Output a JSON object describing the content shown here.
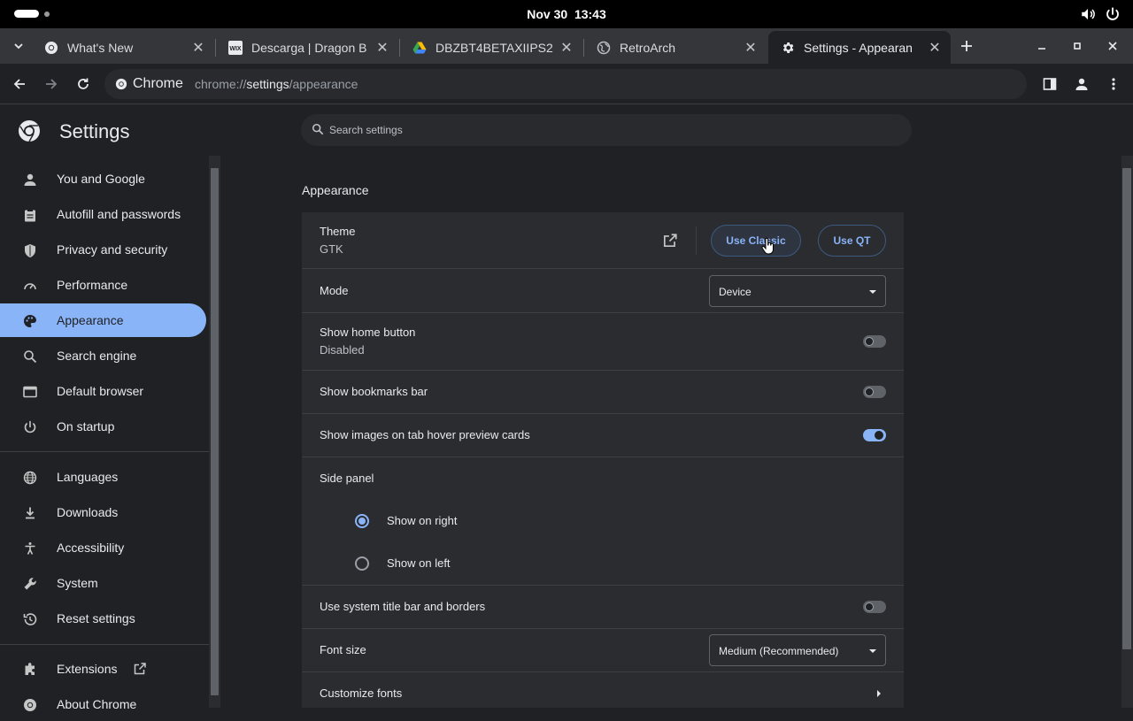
{
  "system": {
    "date": "Nov 30",
    "time": "13:43"
  },
  "tabs": [
    {
      "title": "What's New",
      "icon": "chrome-icon"
    },
    {
      "title": "Descarga | Dragon B",
      "icon": "wix-icon"
    },
    {
      "title": "DBZBT4BETAXIIPS2",
      "icon": "google-drive-icon"
    },
    {
      "title": "RetroArch",
      "icon": "globe-icon"
    },
    {
      "title": "Settings - Appearan",
      "icon": "gear-icon"
    }
  ],
  "toolbar": {
    "chip_label": "Chrome",
    "url_prefix": "chrome://",
    "url_path": "settings",
    "url_suffix": "/appearance"
  },
  "settings": {
    "title": "Settings",
    "search_placeholder": "Search settings"
  },
  "sidebar": {
    "items": [
      {
        "label": "You and Google",
        "icon": "person-icon"
      },
      {
        "label": "Autofill and passwords",
        "icon": "clipboard-icon"
      },
      {
        "label": "Privacy and security",
        "icon": "shield-icon"
      },
      {
        "label": "Performance",
        "icon": "speedometer-icon"
      },
      {
        "label": "Appearance",
        "icon": "palette-icon"
      },
      {
        "label": "Search engine",
        "icon": "search-icon"
      },
      {
        "label": "Default browser",
        "icon": "browser-icon"
      },
      {
        "label": "On startup",
        "icon": "power-icon"
      },
      {
        "label": "Languages",
        "icon": "globe-icon"
      },
      {
        "label": "Downloads",
        "icon": "download-icon"
      },
      {
        "label": "Accessibility",
        "icon": "accessibility-icon"
      },
      {
        "label": "System",
        "icon": "wrench-icon"
      },
      {
        "label": "Reset settings",
        "icon": "history-icon"
      },
      {
        "label": "Extensions",
        "icon": "puzzle-icon"
      },
      {
        "label": "About Chrome",
        "icon": "chrome-icon"
      }
    ],
    "selected": "Appearance"
  },
  "appearance": {
    "section_title": "Appearance",
    "theme": {
      "label": "Theme",
      "value": "GTK",
      "use_classic": "Use Classic",
      "use_qt": "Use QT"
    },
    "mode": {
      "label": "Mode",
      "value": "Device"
    },
    "home_button": {
      "label": "Show home button",
      "sub": "Disabled",
      "on": false
    },
    "bookmarks_bar": {
      "label": "Show bookmarks bar",
      "on": false
    },
    "hover_cards": {
      "label": "Show images on tab hover preview cards",
      "on": true
    },
    "side_panel": {
      "label": "Side panel",
      "right": "Show on right",
      "left": "Show on left",
      "selected": "right"
    },
    "title_bar": {
      "label": "Use system title bar and borders",
      "on": false
    },
    "font_size": {
      "label": "Font size",
      "value": "Medium (Recommended)"
    },
    "customize_fonts": {
      "label": "Customize fonts"
    }
  },
  "colors": {
    "accent": "#8ab4f8",
    "background": "#202124",
    "card": "#2b2c2f"
  }
}
